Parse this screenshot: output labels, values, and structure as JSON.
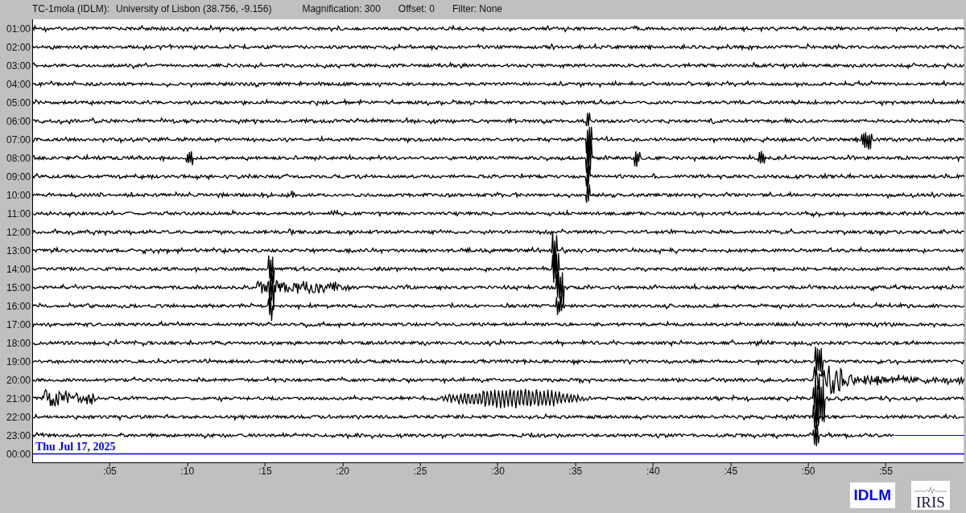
{
  "header": {
    "station": "TC-1mola (IDLM):",
    "location": "University of Lisbon (38.756, -9.156)",
    "magnification": "Magnification: 300",
    "offset": "Offset: 0",
    "filter": "Filter: None"
  },
  "rows": [
    {
      "label": "01:00",
      "kind": "trace"
    },
    {
      "label": "02:00",
      "kind": "trace"
    },
    {
      "label": "03:00",
      "kind": "trace"
    },
    {
      "label": "04:00",
      "kind": "trace"
    },
    {
      "label": "05:00",
      "kind": "trace"
    },
    {
      "label": "06:00",
      "kind": "trace"
    },
    {
      "label": "07:00",
      "kind": "trace"
    },
    {
      "label": "08:00",
      "kind": "trace"
    },
    {
      "label": "09:00",
      "kind": "trace"
    },
    {
      "label": "10:00",
      "kind": "trace"
    },
    {
      "label": "11:00",
      "kind": "trace"
    },
    {
      "label": "12:00",
      "kind": "trace"
    },
    {
      "label": "13:00",
      "kind": "trace"
    },
    {
      "label": "14:00",
      "kind": "trace"
    },
    {
      "label": "15:00",
      "kind": "trace"
    },
    {
      "label": "16:00",
      "kind": "trace"
    },
    {
      "label": "17:00",
      "kind": "trace"
    },
    {
      "label": "18:00",
      "kind": "trace"
    },
    {
      "label": "19:00",
      "kind": "trace"
    },
    {
      "label": "20:00",
      "kind": "trace"
    },
    {
      "label": "21:00",
      "kind": "trace"
    },
    {
      "label": "22:00",
      "kind": "trace"
    },
    {
      "label": "23:00",
      "kind": "partial"
    },
    {
      "label": "00:00",
      "kind": "pending"
    }
  ],
  "date": "Thu Jul 17, 2025",
  "x_ticks": [
    ":05",
    ":10",
    ":15",
    ":20",
    ":25",
    ":30",
    ":35",
    ":40",
    ":45",
    ":50",
    ":55"
  ],
  "logos": [
    {
      "text": "IDLM",
      "kind": "station"
    },
    {
      "text": "IRIS",
      "kind": "network"
    }
  ]
}
